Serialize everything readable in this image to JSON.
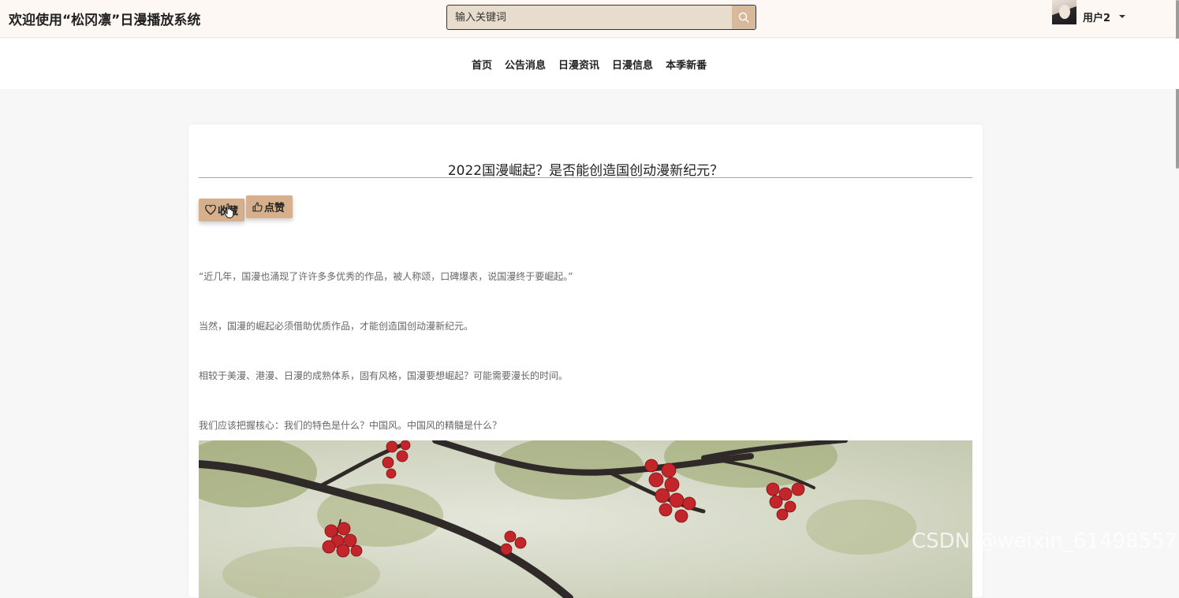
{
  "header": {
    "site_title": "欢迎使用“松冈凛”日漫播放系统",
    "search_placeholder": "输入关键词",
    "username": "用户2"
  },
  "nav": {
    "items": [
      "首页",
      "公告消息",
      "日漫资讯",
      "日漫信息",
      "本季新番"
    ]
  },
  "article": {
    "title": "2022国漫崛起？是否能创造国创动漫新纪元？",
    "favorite_label": "收藏",
    "like_label": "点赞",
    "paragraphs": [
      "“近几年，国漫也涌现了许许多多优秀的作品，被人称颂，口碑爆表，说国漫终于要崛起。”",
      "当然，国漫的崛起必须借助优质作品，才能创造国创动漫新纪元。",
      "相较于美漫、港漫、日漫的成熟体系，固有风格，国漫要想崛起？可能需要漫长的时间。",
      "我们应该把握核心：我们的特色是什么？中国风。中国风的精髓是什么？"
    ]
  },
  "watermark": "CSDN @weixin_61498557",
  "colors": {
    "header_bg": "#fdf8f4",
    "search_bg": "#e8dccc",
    "accent": "#d6b08d",
    "title_line": "#c49f7e"
  }
}
